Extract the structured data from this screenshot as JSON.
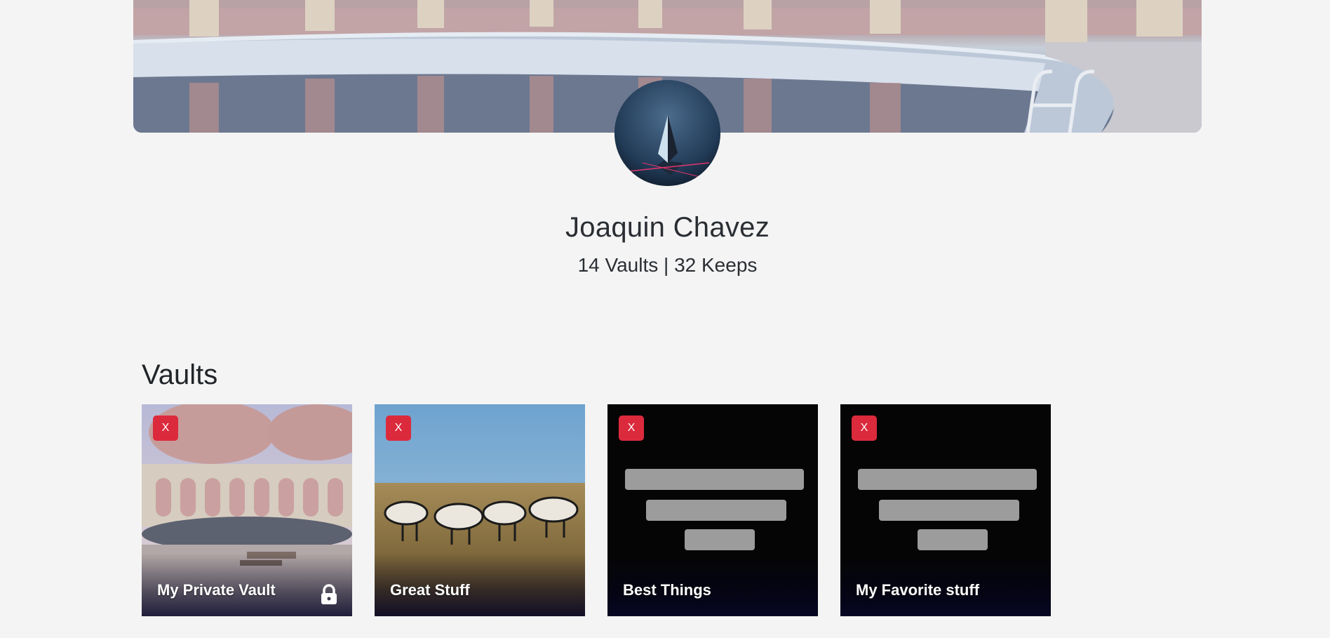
{
  "profile": {
    "name": "Joaquin Chavez",
    "stats": "14 Vaults | 32 Keeps"
  },
  "vaults_section": {
    "heading": "Vaults",
    "delete_label": "X",
    "items": [
      {
        "title": "My Private Vault",
        "private": true,
        "icon": "lock-icon"
      },
      {
        "title": "Great Stuff",
        "private": false
      },
      {
        "title": "Best Things",
        "private": false
      },
      {
        "title": "My Favorite stuff",
        "private": false
      }
    ]
  },
  "colors": {
    "background": "#f4f4f4",
    "delete_button": "#dc2a3d",
    "text": "#212529"
  }
}
